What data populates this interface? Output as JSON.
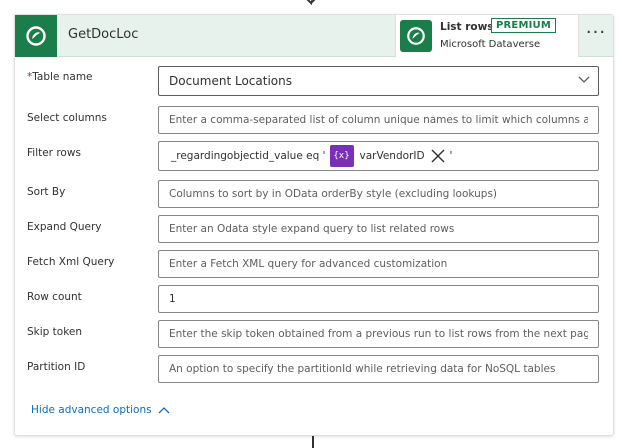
{
  "header": {
    "title": "GetDocLoc",
    "operation_name": "List rows",
    "badge": "PREMIUM",
    "connector": "Microsoft Dataverse",
    "more": "···"
  },
  "fields": {
    "table_name": {
      "label": "Table name",
      "required_mark": "*",
      "value": "Document Locations"
    },
    "select_columns": {
      "label": "Select columns",
      "placeholder": "Enter a comma-separated list of column unique names to limit which columns a"
    },
    "filter_rows": {
      "label": "Filter rows",
      "prefix": "_regardingobjectid_value eq '",
      "token_icon": "{x}",
      "token_label": "varVendorID",
      "suffix": "'"
    },
    "sort_by": {
      "label": "Sort By",
      "placeholder": "Columns to sort by in OData orderBy style (excluding lookups)"
    },
    "expand_query": {
      "label": "Expand Query",
      "placeholder": "Enter an Odata style expand query to list related rows"
    },
    "fetch_xml_query": {
      "label": "Fetch Xml Query",
      "placeholder": "Enter a Fetch XML query for advanced customization"
    },
    "row_count": {
      "label": "Row count",
      "value": "1"
    },
    "skip_token": {
      "label": "Skip token",
      "placeholder": "Enter the skip token obtained from a previous run to list rows from the next pag"
    },
    "partition_id": {
      "label": "Partition ID",
      "placeholder": "An option to specify the partitionId while retrieving data for NoSQL tables"
    }
  },
  "footer": {
    "hide_advanced_label": "Hide advanced options"
  },
  "colors": {
    "brand_green": "#1b7d4a",
    "header_bg": "#e7f2ec",
    "token_purple": "#7a2fb8",
    "link_blue": "#0f6cbd"
  }
}
